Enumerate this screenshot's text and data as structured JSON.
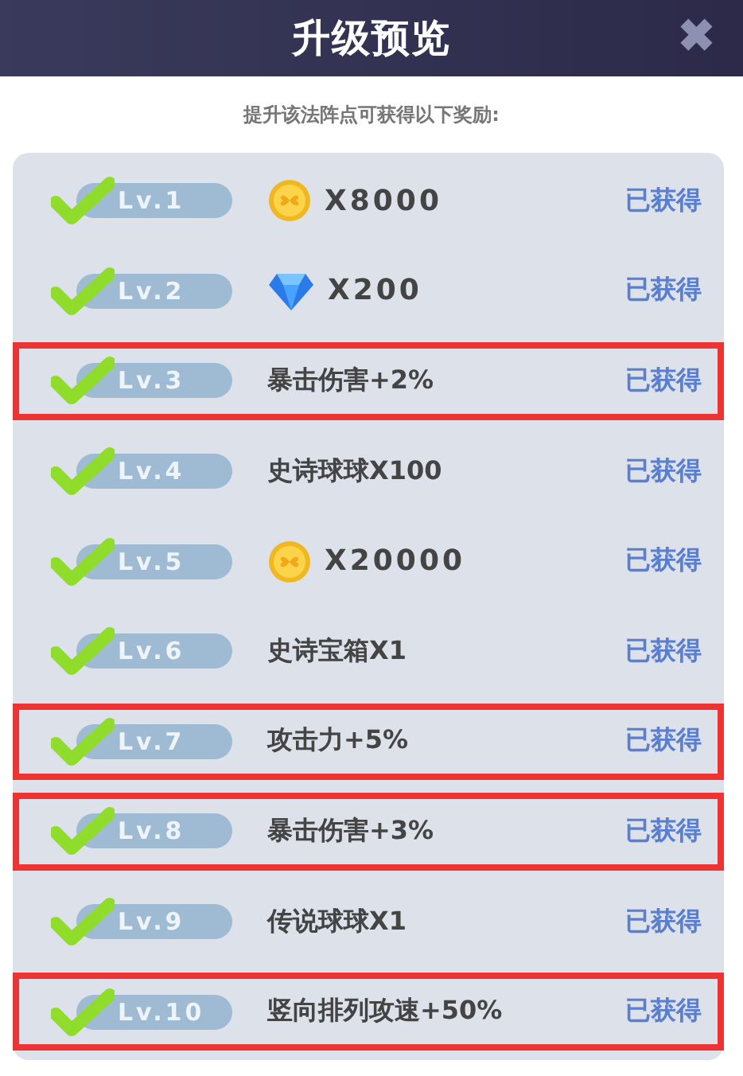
{
  "header": {
    "title": "升级预览",
    "close": "✖"
  },
  "subtitle": "提升该法阵点可获得以下奖励:",
  "rows": [
    {
      "level": "Lv.1",
      "claimed": true,
      "highlighted": false,
      "reward": {
        "kind": "coin",
        "text": "X8000"
      },
      "status": "已获得"
    },
    {
      "level": "Lv.2",
      "claimed": true,
      "highlighted": false,
      "reward": {
        "kind": "gem",
        "text": "X200"
      },
      "status": "已获得"
    },
    {
      "level": "Lv.3",
      "claimed": true,
      "highlighted": true,
      "reward": {
        "kind": "text",
        "text": "暴击伤害+2%"
      },
      "status": "已获得"
    },
    {
      "level": "Lv.4",
      "claimed": true,
      "highlighted": false,
      "reward": {
        "kind": "text",
        "text": "史诗球球X100"
      },
      "status": "已获得"
    },
    {
      "level": "Lv.5",
      "claimed": true,
      "highlighted": false,
      "reward": {
        "kind": "coin",
        "text": "X20000"
      },
      "status": "已获得"
    },
    {
      "level": "Lv.6",
      "claimed": true,
      "highlighted": false,
      "reward": {
        "kind": "text",
        "text": "史诗宝箱X1"
      },
      "status": "已获得"
    },
    {
      "level": "Lv.7",
      "claimed": true,
      "highlighted": true,
      "reward": {
        "kind": "text",
        "text": "攻击力+5%"
      },
      "status": "已获得"
    },
    {
      "level": "Lv.8",
      "claimed": true,
      "highlighted": true,
      "reward": {
        "kind": "text",
        "text": "暴击伤害+3%"
      },
      "status": "已获得"
    },
    {
      "level": "Lv.9",
      "claimed": true,
      "highlighted": false,
      "reward": {
        "kind": "text",
        "text": "传说球球X1"
      },
      "status": "已获得"
    },
    {
      "level": "Lv.10",
      "claimed": true,
      "highlighted": true,
      "reward": {
        "kind": "text",
        "text": "竖向排列攻速+50%"
      },
      "status": "已获得"
    }
  ]
}
